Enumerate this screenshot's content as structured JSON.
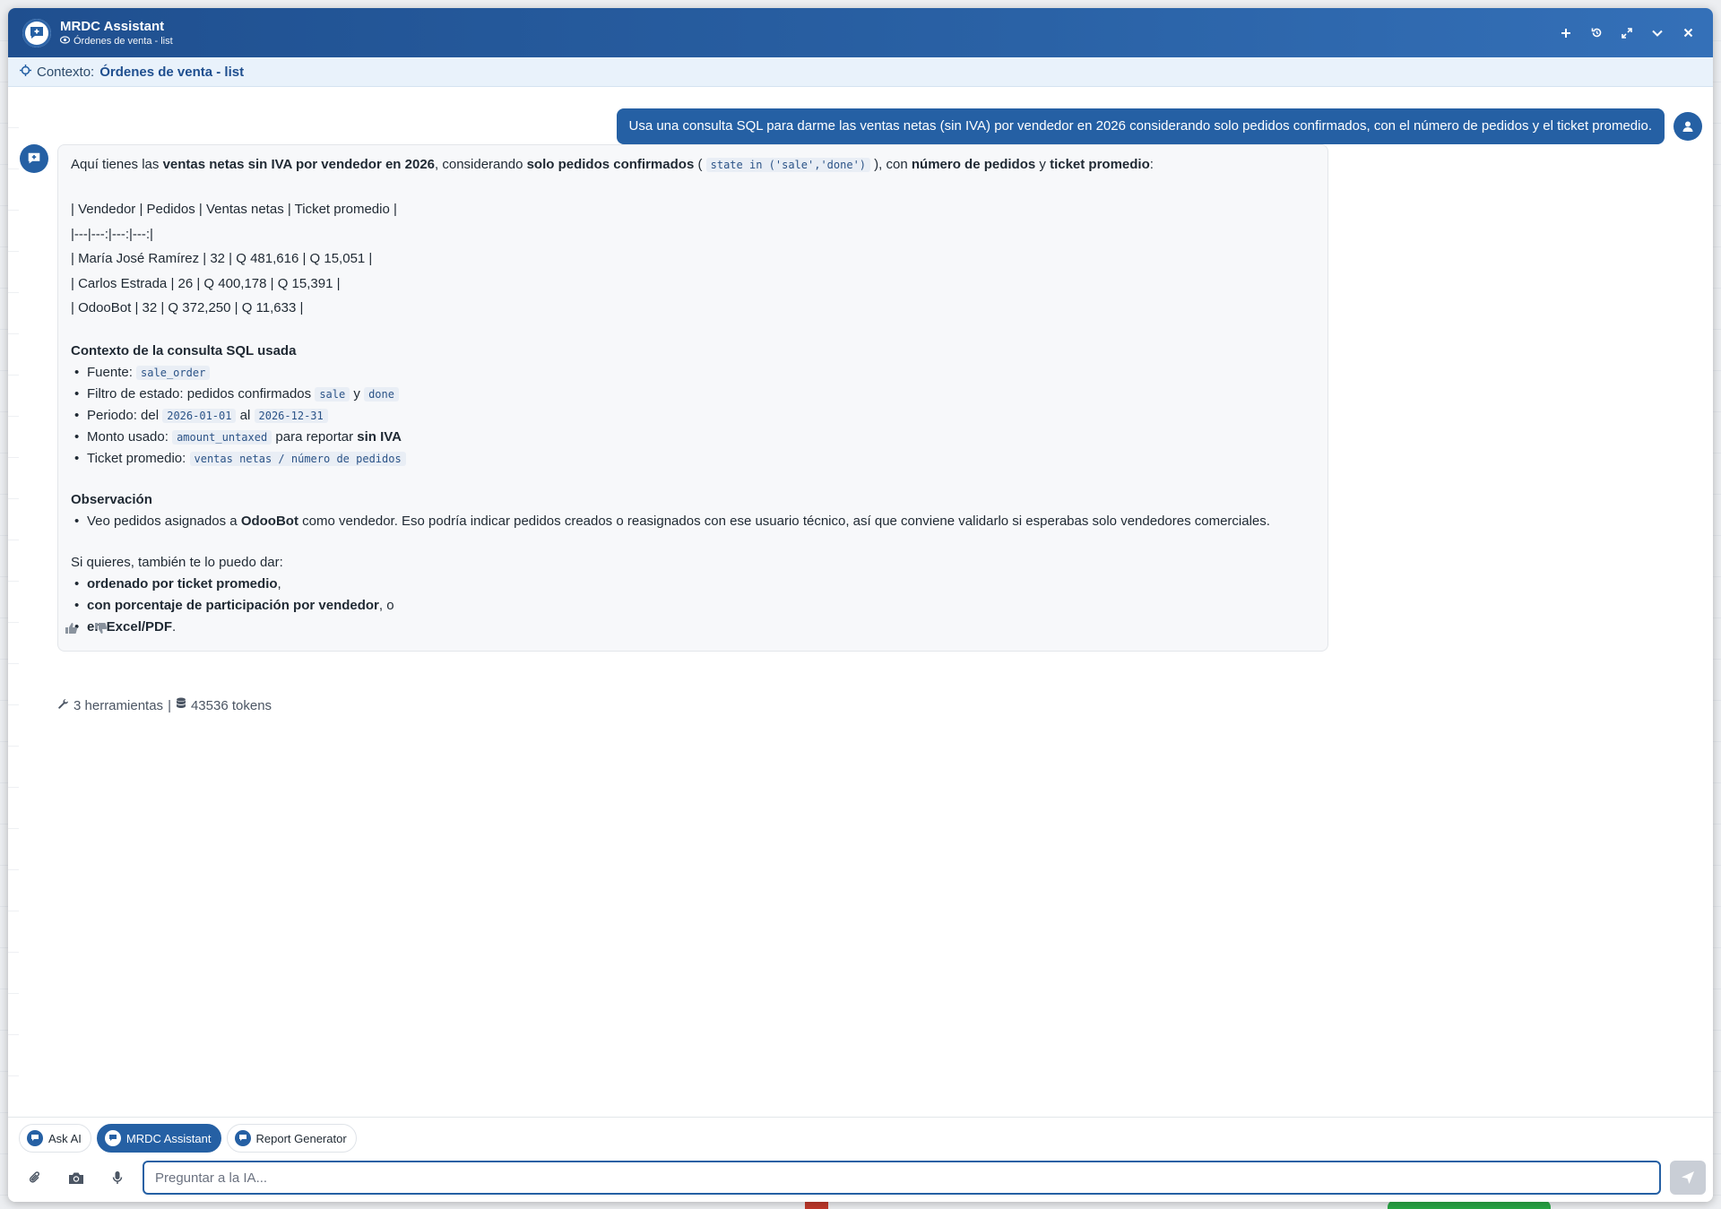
{
  "window": {
    "title": "MRDC Assistant",
    "subtitle": "Órdenes de venta - list",
    "buttons": [
      "new-chat",
      "history",
      "expand",
      "minimize",
      "close"
    ]
  },
  "context": {
    "label": "Contexto:",
    "value": "Órdenes de venta - list"
  },
  "user_message": "Usa una consulta SQL para darme las ventas netas (sin IVA) por vendedor en 2026 considerando solo pedidos confirmados, con el número de pedidos y el ticket promedio.",
  "bot_message": {
    "intro": {
      "p1": "Aquí tienes las ",
      "b1": "ventas netas sin IVA por vendedor en 2026",
      "p2": ", considerando ",
      "b2": "solo pedidos confirmados",
      "p3": " ( ",
      "code": "state in ('sale','done')",
      "p4": " ), con ",
      "b3": "número de pedidos",
      "p5": " y ",
      "b4": "ticket promedio",
      "p6": ":"
    },
    "table_lines": [
      "| Vendedor | Pedidos | Ventas netas | Ticket promedio |",
      "|---|---:|---:|---:|",
      "| María José Ramírez | 32 | Q 481,616 | Q 15,051 |",
      "| Carlos Estrada | 26 | Q 400,178 | Q 15,391 |",
      "| OdooBot | 32 | Q 372,250 | Q 11,633 |"
    ],
    "sql_context": {
      "title": "Contexto de la consulta SQL usada",
      "fuente_label": "Fuente: ",
      "fuente_code": "sale_order",
      "filtro_label": "Filtro de estado: pedidos confirmados ",
      "filtro_code1": "sale",
      "filtro_mid": " y ",
      "filtro_code2": "done",
      "periodo_label": "Periodo: del ",
      "periodo_from": "2026-01-01",
      "periodo_mid": " al ",
      "periodo_to": "2026-12-31",
      "monto_label": "Monto usado: ",
      "monto_code": "amount_untaxed",
      "monto_mid": " para reportar ",
      "monto_bold": "sin IVA",
      "ticket_label": "Ticket promedio: ",
      "ticket_code": "ventas netas / número de pedidos"
    },
    "observation": {
      "title": "Observación",
      "p1": "Veo pedidos asignados a ",
      "bold": "OdooBot",
      "p2": " como vendedor. Eso podría indicar pedidos creados o reasignados con ese usuario técnico, así que conviene validarlo si esperabas solo vendedores comerciales."
    },
    "offer": {
      "intro": "Si quieres, también te lo puedo dar:",
      "o1_bold": "ordenado por ticket promedio",
      "o1_rest": ",",
      "o2_bold": "con porcentaje de participación por vendedor",
      "o2_rest": ", o",
      "o3_bold": "en Excel/PDF",
      "o3_rest": "."
    }
  },
  "meta": {
    "tools": "3 herramientas",
    "separator": "|",
    "tokens": "43536 tokens"
  },
  "modes": [
    {
      "label": "Ask AI",
      "active": false
    },
    {
      "label": "MRDC Assistant",
      "active": true
    },
    {
      "label": "Report Generator",
      "active": false
    }
  ],
  "input": {
    "placeholder": "Preguntar a la IA..."
  },
  "colors": {
    "primary": "#2560a4",
    "header_start": "#1f4f8f",
    "header_end": "#3470b8"
  }
}
